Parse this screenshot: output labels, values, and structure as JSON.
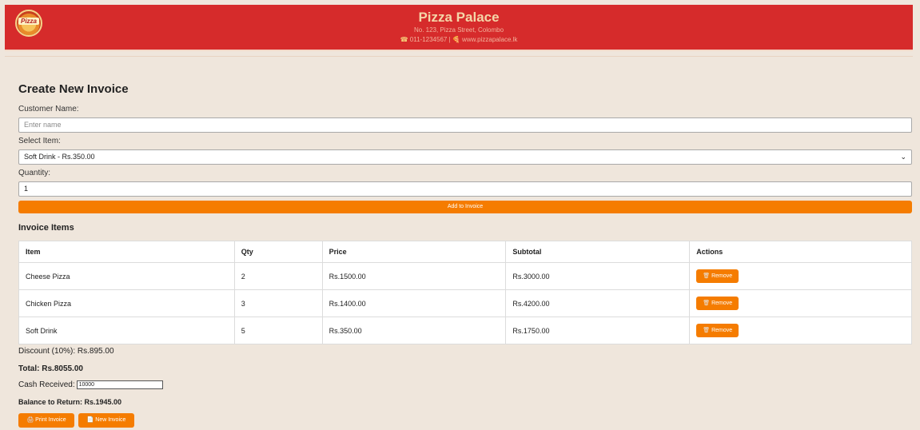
{
  "header": {
    "logo_text": "Pizza",
    "name": "Pizza Palace",
    "address": "No. 123, Pizza Street, Colombo",
    "contact": "011-1234567 | 🍕 www.pizzapalace.lk",
    "phone_icon": "☎"
  },
  "form": {
    "title": "Create New Invoice",
    "customer_label": "Customer Name:",
    "customer_placeholder": "Enter name",
    "item_label": "Select Item:",
    "item_selected": "Soft Drink - Rs.350.00",
    "quantity_label": "Quantity:",
    "quantity_value": "1",
    "add_button": "Add to Invoice"
  },
  "items": {
    "title": "Invoice Items",
    "headers": [
      "Item",
      "Qty",
      "Price",
      "Subtotal",
      "Actions"
    ],
    "rows": [
      {
        "item": "Cheese Pizza",
        "qty": "2",
        "price": "Rs.1500.00",
        "subtotal": "Rs.3000.00",
        "action": "Remove"
      },
      {
        "item": "Chicken Pizza",
        "qty": "3",
        "price": "Rs.1400.00",
        "subtotal": "Rs.4200.00",
        "action": "Remove"
      },
      {
        "item": "Soft Drink",
        "qty": "5",
        "price": "Rs.350.00",
        "subtotal": "Rs.1750.00",
        "action": "Remove"
      }
    ]
  },
  "summary": {
    "discount": "Discount (10%): Rs.895.00",
    "total": "Total: Rs.8055.00",
    "cash_label": "Cash Received:",
    "cash_value": "10000",
    "balance": "Balance to Return: Rs.1945.00"
  },
  "actions": {
    "print": "Print Invoice",
    "new": "New Invoice"
  },
  "colors": {
    "header": "#d62b2b",
    "accent": "#f57c00",
    "background": "#efe6dc"
  }
}
